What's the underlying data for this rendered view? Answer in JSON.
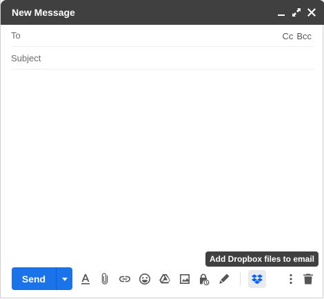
{
  "window": {
    "title": "New Message"
  },
  "fields": {
    "to_label": "To",
    "cc_label": "Cc",
    "bcc_label": "Bcc",
    "subject_label": "Subject"
  },
  "toolbar": {
    "send_label": "Send",
    "tooltip": "Add Dropbox files to email",
    "icons": [
      "formatting-icon",
      "attach-icon",
      "link-icon",
      "emoji-icon",
      "drive-icon",
      "photo-icon",
      "confidential-icon",
      "signature-icon",
      "dropbox-icon",
      "more-options-icon",
      "discard-icon"
    ]
  },
  "colors": {
    "titlebar": "#404040",
    "send": "#1a73e8",
    "dropbox": "#0061fe"
  }
}
